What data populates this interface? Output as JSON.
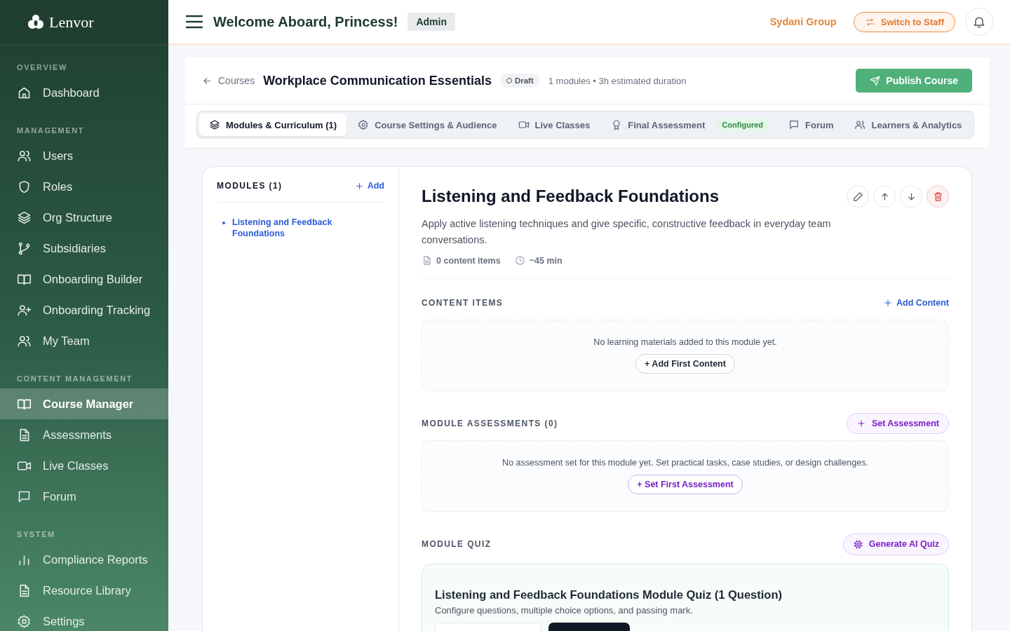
{
  "brand": "Lenvor",
  "sidebar": {
    "sections": [
      {
        "label": "OVERVIEW",
        "items": [
          {
            "label": "Dashboard",
            "selected": false
          }
        ]
      },
      {
        "label": "MANAGEMENT",
        "items": [
          {
            "label": "Users",
            "selected": false
          },
          {
            "label": "Roles",
            "selected": false
          },
          {
            "label": "Org Structure",
            "selected": false
          },
          {
            "label": "Subsidiaries",
            "selected": false
          },
          {
            "label": "Onboarding Builder",
            "selected": false
          },
          {
            "label": "Onboarding Tracking",
            "selected": false
          },
          {
            "label": "My Team",
            "selected": false
          }
        ]
      },
      {
        "label": "CONTENT MANAGEMENT",
        "items": [
          {
            "label": "Course Manager",
            "selected": true
          },
          {
            "label": "Assessments",
            "selected": false
          },
          {
            "label": "Live Classes",
            "selected": false
          },
          {
            "label": "Forum",
            "selected": false
          }
        ]
      },
      {
        "label": "SYSTEM",
        "items": [
          {
            "label": "Compliance Reports",
            "selected": false
          },
          {
            "label": "Resource Library",
            "selected": false
          },
          {
            "label": "Settings",
            "selected": false
          }
        ]
      }
    ]
  },
  "header": {
    "greeting": "Welcome Aboard, Princess!",
    "role": "Admin",
    "organization": "Sydani Group",
    "switch_button": "Switch to Staff"
  },
  "course": {
    "back": "Courses",
    "title": "Workplace Communication Essentials",
    "status": "Draft",
    "meta": "1 modules • 3h estimated duration",
    "publish_button": "Publish Course"
  },
  "tabs": [
    {
      "label": "Modules & Curriculum (1)",
      "selected": true
    },
    {
      "label": "Course Settings & Audience",
      "selected": false
    },
    {
      "label": "Live Classes",
      "selected": false
    },
    {
      "label": "Final Assessment",
      "selected": false,
      "badge": "Configured"
    },
    {
      "label": "Forum",
      "selected": false
    },
    {
      "label": "Learners & Analytics",
      "selected": false
    }
  ],
  "modules": {
    "heading": "MODULES (1)",
    "add": "Add",
    "items": [
      {
        "label": "Listening and Feedback Foundations",
        "selected": true
      }
    ]
  },
  "module": {
    "title": "Listening and Feedback Foundations",
    "description": "Apply active listening techniques and give specific, constructive feedback in everyday team conversations.",
    "content_count": "0 content items",
    "duration": "~45 min",
    "content": {
      "heading": "CONTENT ITEMS",
      "action": "Add Content",
      "empty": "No learning materials added to this module yet.",
      "empty_button": "+ Add First Content"
    },
    "assessments": {
      "heading": "MODULE ASSESSMENTS (0)",
      "action": "Set Assessment",
      "empty": "No assessment set for this module yet. Set practical tasks, case studies, or design challenges.",
      "empty_button": "+ Set First Assessment"
    },
    "quiz": {
      "heading": "MODULE QUIZ",
      "action": "Generate AI Quiz",
      "title": "Listening and Feedback Foundations Module Quiz (1 Question)",
      "subtitle": "Configure questions, multiple choice options, and passing mark."
    }
  }
}
